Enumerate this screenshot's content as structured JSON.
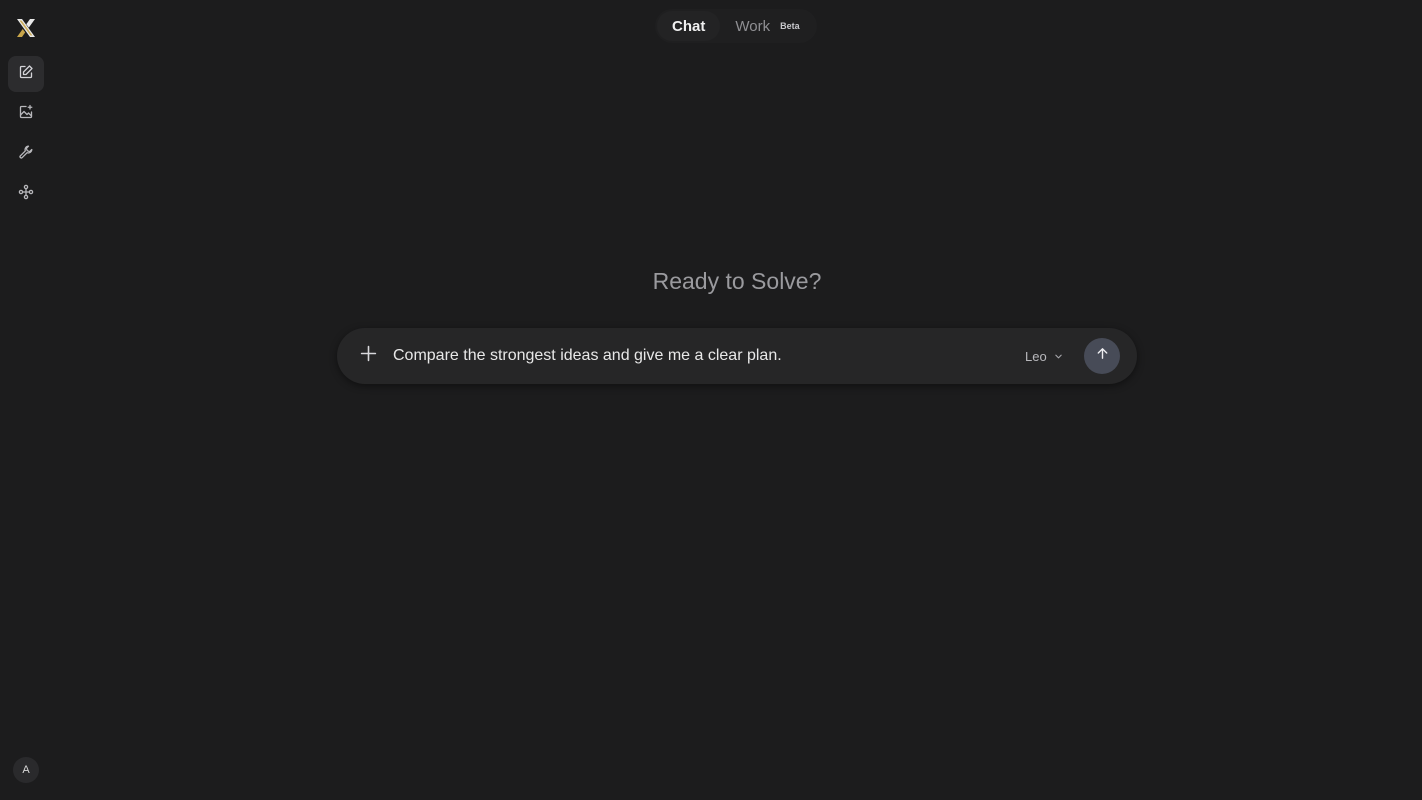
{
  "app": {
    "logo_icon": "x-logo-icon",
    "accent_color": "#c9a64a"
  },
  "sidebar": {
    "items": [
      {
        "name": "new-chat",
        "icon": "edit-icon",
        "active": true
      },
      {
        "name": "image",
        "icon": "image-sparkle-icon",
        "active": false
      },
      {
        "name": "tools",
        "icon": "wrench-icon",
        "active": false
      },
      {
        "name": "connections",
        "icon": "nodes-icon",
        "active": false
      }
    ],
    "avatar_initial": "A"
  },
  "tabs": [
    {
      "label": "Chat",
      "active": true
    },
    {
      "label": "Work",
      "active": false,
      "badge": "Beta"
    }
  ],
  "main": {
    "headline": "Ready to Solve?",
    "composer": {
      "value": "Compare the strongest ideas and give me a clear plan.",
      "plus_icon": "plus-icon",
      "model_label": "Leo",
      "model_icon": "chevron-down-icon",
      "send_icon": "arrow-up-icon"
    }
  }
}
